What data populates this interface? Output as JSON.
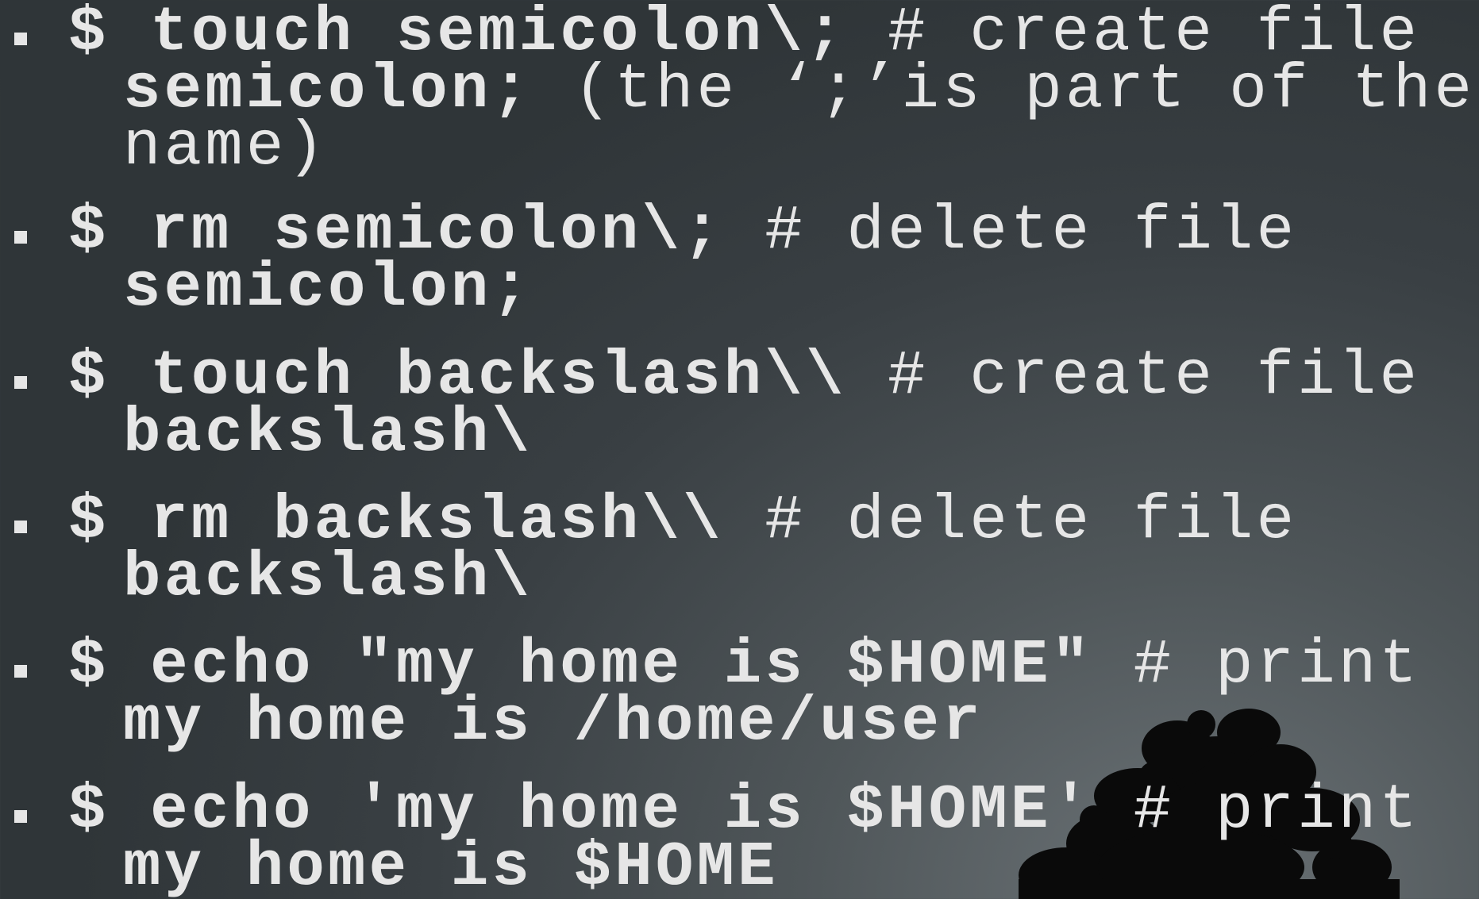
{
  "bullets": [
    {
      "command": "$ touch semicolon\\;",
      "comment_1": " # create file",
      "cont_bold": "semicolon;",
      "cont_rest": " (the ‘;’is part of the",
      "cont2": "name)"
    },
    {
      "command": "$ rm semicolon\\;",
      "comment_1": " # delete file",
      "cont_bold": "semicolon;"
    },
    {
      "command": "$ touch backslash\\\\",
      "comment_1": " # create file",
      "cont_bold": "backslash\\"
    },
    {
      "command": "$ rm backslash\\\\",
      "comment_1": " # delete file",
      "cont_bold": "backslash\\"
    },
    {
      "command": "$ echo \"my home is $HOME\"",
      "comment_1": " # print",
      "cont_bold": "my home is /home/user"
    },
    {
      "command": "$ echo 'my home is $HOME'",
      "comment_1": " # print",
      "cont_bold": "my home is $HOME"
    }
  ],
  "colors": {
    "text": "#e6e6e6",
    "background": "#3a4044"
  },
  "decoration": "tree-silhouette"
}
